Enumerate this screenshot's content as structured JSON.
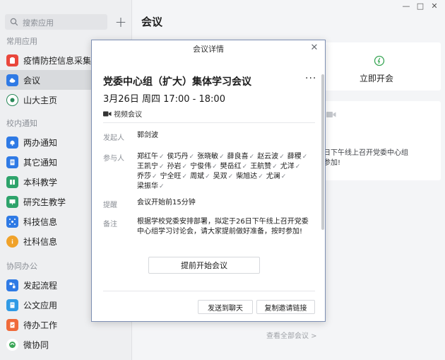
{
  "sidebar": {
    "search_placeholder": "搜索应用",
    "add_label": "+",
    "sections": [
      {
        "label": "常用应用"
      },
      {
        "label": "校内通知"
      },
      {
        "label": "协同办公"
      }
    ],
    "items": [
      {
        "label": "疫情防控信息采集平台",
        "icon": "clipboard-icon",
        "color": "#e9473c"
      },
      {
        "label": "会议",
        "icon": "cloud-icon",
        "color": "#2f7ae5"
      },
      {
        "label": "山大主页",
        "icon": "university-seal-icon",
        "color": "#ffffff"
      },
      {
        "label": "两办通知",
        "icon": "bell-icon",
        "color": "#2f7ae5"
      },
      {
        "label": "其它通知",
        "icon": "document-icon",
        "color": "#2f7ae5"
      },
      {
        "label": "本科教学",
        "icon": "book-icon",
        "color": "#2ea36b"
      },
      {
        "label": "研究生教学",
        "icon": "slides-icon",
        "color": "#2ea36b"
      },
      {
        "label": "科技信息",
        "icon": "network-icon",
        "color": "#2f7ae5"
      },
      {
        "label": "社科信息",
        "icon": "info-icon",
        "color": "#f0a22a"
      },
      {
        "label": "发起流程",
        "icon": "flow-icon",
        "color": "#2f7ae5"
      },
      {
        "label": "公文应用",
        "icon": "doc-app-icon",
        "color": "#2f9ae5"
      },
      {
        "label": "待办工作",
        "icon": "todo-icon",
        "color": "#ef6a3a"
      },
      {
        "label": "微协同",
        "icon": "swirl-icon",
        "color": "#ffffff"
      }
    ]
  },
  "main": {
    "title": "会议",
    "quick_start": "立即开会",
    "bg_text_line1": "日下午线上召开党委中心组",
    "bg_text_line2": "参加!",
    "view_all": "查看全部会议 >",
    "window_controls": [
      "—",
      "□",
      "✕"
    ]
  },
  "modal": {
    "header": "会议详情",
    "close": "✕",
    "title": "党委中心组（扩大）集体学习会议",
    "more": "···",
    "time": "3月26日 周四 17:00 - 18:00",
    "type": "视频会议",
    "initiator_label": "发起人",
    "initiator": "郭剑波",
    "participants_label": "参与人",
    "participants": [
      "郑红午",
      "侯巧丹",
      "张晓敏",
      "薛良喜",
      "赵云波",
      "薛稷",
      "王凯宁",
      "孙岩",
      "宁俊伟",
      "樊岳红",
      "王航赞",
      "尤洋",
      "乔莎",
      "宁全旺",
      "周斌",
      "吴双",
      "柴旭达",
      "尤澜",
      "梁振华"
    ],
    "check_mark": "✓",
    "reminder_label": "提醒",
    "reminder": "会议开始前15分钟",
    "note_label": "备注",
    "note": "根据学校党委安排部署，拟定于26日下午线上召开党委中心组学习讨论会，请大家提前做好准备，按时参加!",
    "start_early_button": "提前开始会议",
    "send_chat_button": "发送到聊天",
    "copy_link_button": "复制邀请链接"
  }
}
